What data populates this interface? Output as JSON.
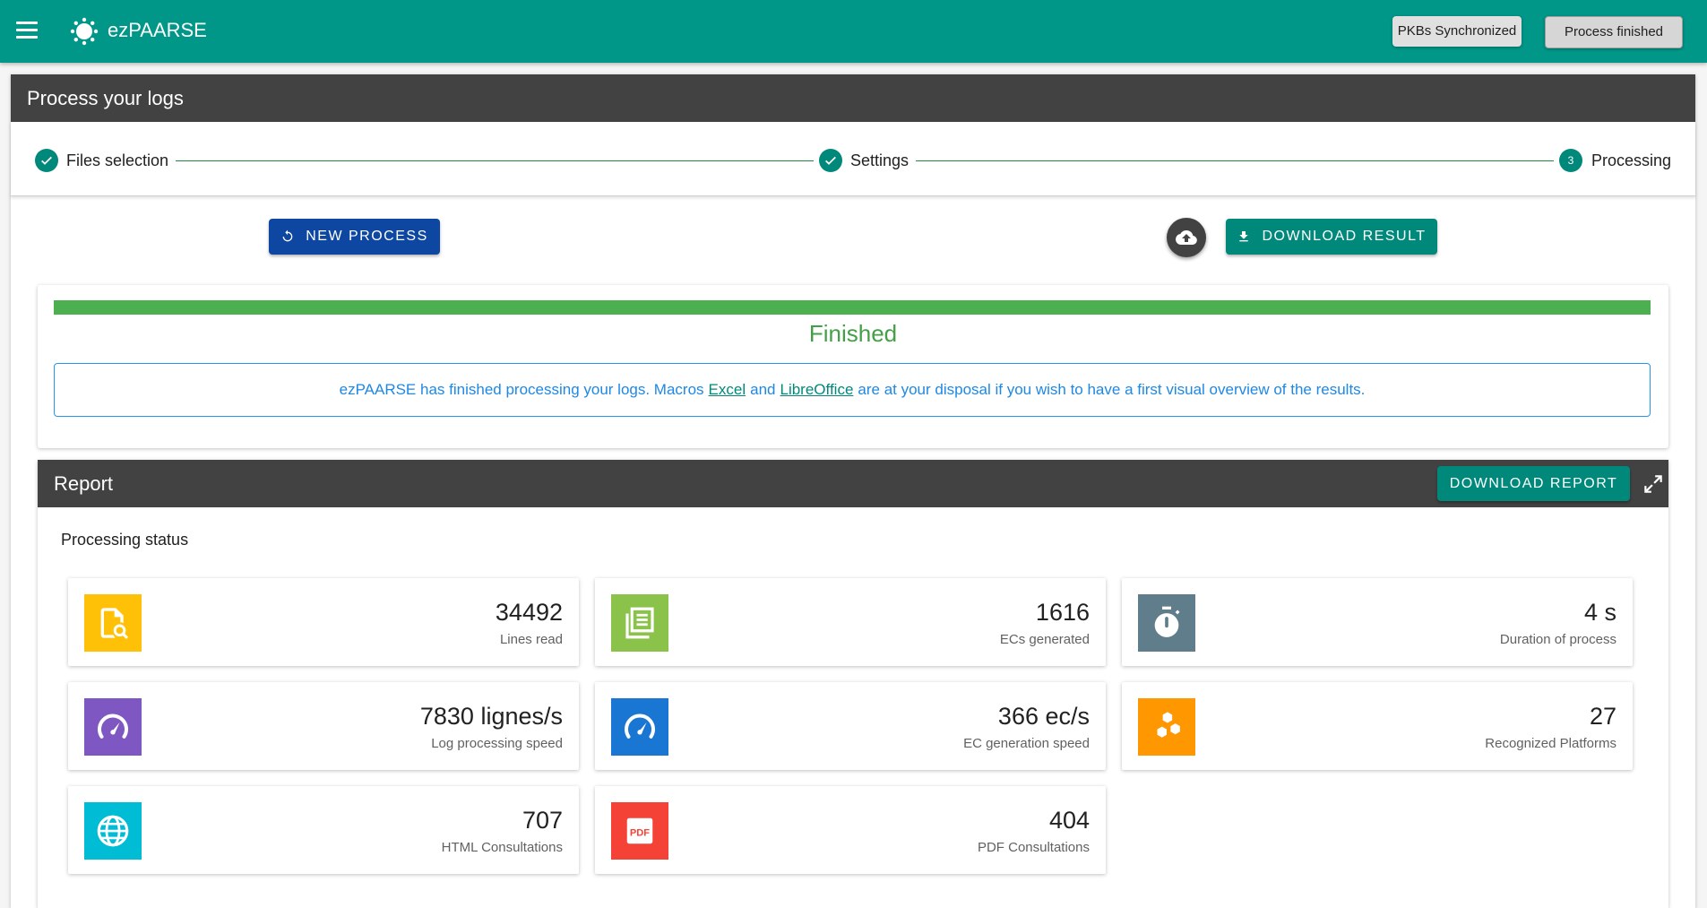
{
  "appbar": {
    "title": "ezPAARSE",
    "pkb_status": "PKBs Synchronized",
    "process_status": "Process finished"
  },
  "main": {
    "title": "Process your logs",
    "steps": [
      {
        "label": "Files selection",
        "state": "done"
      },
      {
        "label": "Settings",
        "state": "done"
      },
      {
        "label": "Processing",
        "number": "3",
        "state": "active"
      }
    ],
    "new_process_label": "New process",
    "download_result_label": "Download result"
  },
  "status": {
    "progress_percent": 100,
    "finished_label": "Finished",
    "info_before": "ezPAARSE has finished processing your logs. Macros",
    "excel_link": "Excel",
    "and_text": "and",
    "libreoffice_link": "LibreOffice",
    "info_after": "are at your disposal if you wish to have a first visual overview of the results."
  },
  "report": {
    "title": "Report",
    "download_report_label": "Download report",
    "processing_status_title": "Processing status",
    "stats": [
      {
        "value": "34492",
        "label": "Lines read",
        "color": "#ffc107",
        "icon": "file-search-icon"
      },
      {
        "value": "1616",
        "label": "ECs generated",
        "color": "#8bc34a",
        "icon": "newspaper-icon"
      },
      {
        "value": "4 s",
        "label": "Duration of process",
        "color": "#607d8b",
        "icon": "timer-icon"
      },
      {
        "value": "7830 lignes/s",
        "label": "Log processing speed",
        "color": "#7e57c2",
        "icon": "speedometer-icon"
      },
      {
        "value": "366 ec/s",
        "label": "EC generation speed",
        "color": "#1976d2",
        "icon": "speedometer-icon"
      },
      {
        "value": "27",
        "label": "Recognized Platforms",
        "color": "#ff9800",
        "icon": "hexagon-multiple-icon"
      },
      {
        "value": "707",
        "label": "HTML Consultations",
        "color": "#00bcd4",
        "icon": "web-icon"
      },
      {
        "value": "404",
        "label": "PDF Consultations",
        "color": "#f44336",
        "icon": "pdf-file-icon"
      }
    ]
  },
  "colors": {
    "appbar": "#009688",
    "header_dark": "#424242",
    "new_process_button": "#0d47a1",
    "teal_button": "#00897b",
    "progress": "#4caf50",
    "info_text": "#1e88e5"
  }
}
